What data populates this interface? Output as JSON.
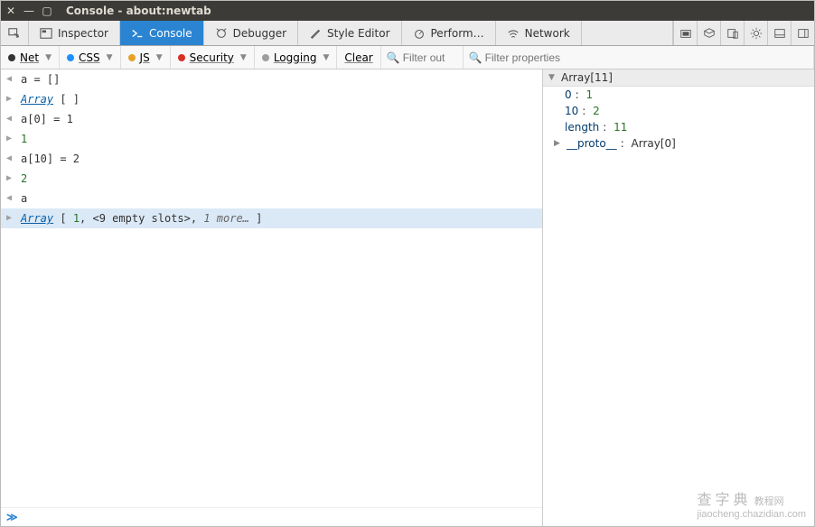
{
  "window": {
    "title": "Console - about:newtab"
  },
  "tabs": {
    "inspector": "Inspector",
    "console": "Console",
    "debugger": "Debugger",
    "style": "Style Editor",
    "perf": "Perform…",
    "network": "Network"
  },
  "filters": {
    "net": "Net",
    "css": "CSS",
    "js": "JS",
    "security": "Security",
    "logging": "Logging",
    "clear": "Clear",
    "filter_out_placeholder": "Filter out",
    "filter_props_placeholder": "Filter properties"
  },
  "log": {
    "l0": "a = []",
    "l1_pre": "Array",
    "l1_post": " [  ]",
    "l2": "a[0] = 1",
    "l3": "1",
    "l4": "a[10] = 2",
    "l5": "2",
    "l6": "a",
    "l7_link": "Array",
    "l7_br1": " [ ",
    "l7_n1": "1",
    "l7_mid": ", <9 empty slots>, ",
    "l7_more": "1 more…",
    "l7_br2": " ]"
  },
  "inspect": {
    "header": "Array[11]",
    "k0": "0",
    "v0": "1",
    "k1": "10",
    "v1": "2",
    "klen": "length",
    "vlen": "11",
    "kproto": "__proto__",
    "vproto": "Array[0]"
  },
  "watermark": {
    "big": "查字典",
    "small": "jiaocheng.chazidian.com",
    "tag": "教程网"
  }
}
